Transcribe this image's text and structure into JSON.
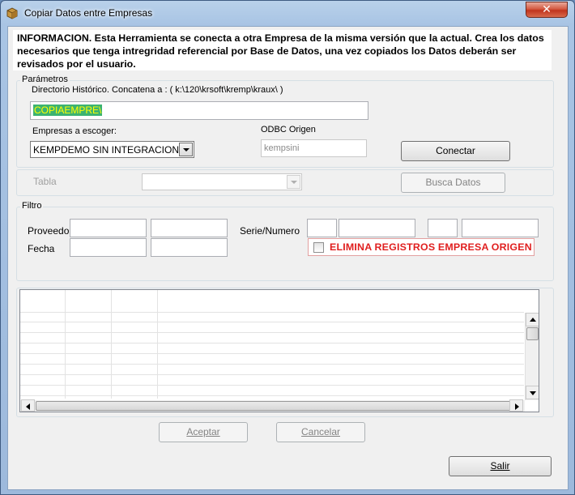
{
  "window": {
    "title": "Copiar Datos entre Empresas",
    "close_label": "✕"
  },
  "info": {
    "text": "INFORMACION. Esta Herramienta se conecta a otra Empresa de la misma versión que la actual. Crea los datos necesarios que tenga intregridad referencial por Base de Datos, una vez copiados los Datos deberán ser revisados por el usuario."
  },
  "parametros": {
    "group_label": "Parámetros",
    "directorio_label": "Directorio Histórico. Concatena a :  ( k:\\120\\krsoft\\kremp\\kraux\\ )",
    "directorio_value": "COPIAEMPRE\\",
    "empresas_label": "Empresas a escoger:",
    "empresas_value": "KEMPDEMO SIN INTEGRACION",
    "odbc_label": "ODBC Origen",
    "odbc_value": "kempsini",
    "conectar_label": "Conectar"
  },
  "tabla": {
    "label": "Tabla",
    "value": "",
    "busca_label": "Busca Datos"
  },
  "filtro": {
    "group_label": "Filtro",
    "proveedor_label": "Proveedor",
    "fecha_label": "Fecha",
    "serie_label": "Serie/Numero",
    "elimina_label": "ELIMINA REGISTROS EMPRESA ORIGEN",
    "elimina_checked": false
  },
  "buttons": {
    "aceptar": "Aceptar",
    "cancelar": "Cancelar",
    "salir": "Salir"
  },
  "colors": {
    "selection_bg": "#3cb371",
    "selection_fg": "#ffff00",
    "warning_red": "#e02020"
  }
}
